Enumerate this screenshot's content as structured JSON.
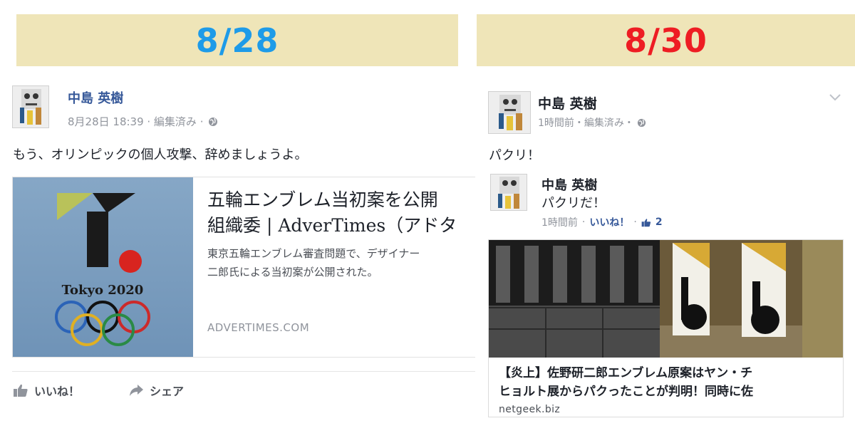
{
  "left_panel": {
    "date": "8/28",
    "author": "中島 英樹",
    "meta": "8月28日 18:39 · 編集済み ·",
    "post_text": "もう、オリンピックの個人攻撃、辞めましょうよ。",
    "link_card": {
      "title": "五輪エンブレム当初案を公開\n組織委 | AdverTimes（アドタ",
      "description": "東京五輪エンブレム審査問題で、デザイナー\n二郎氏による当初案が公開された。",
      "image_caption": "Tokyo 2020",
      "domain": "ADVERTIMES.COM"
    },
    "actions": {
      "like": "いいね！",
      "share": "シェア"
    }
  },
  "right_panel": {
    "date": "8/30",
    "author": "中島 英樹",
    "meta": "1時間前・編集済み・",
    "post_text": "パクリ！",
    "shared_post": {
      "author": "中島 英樹",
      "text": "パクリだ！",
      "time": "1時間前",
      "like_link": "いいね！",
      "like_count": "2"
    },
    "link_card": {
      "title": "【炎上】佐野研二郎エンブレム原案はヤン・チ\nヒョルト展からパクったことが判明！同時に佐",
      "domain": "netgeek.biz"
    }
  },
  "colors": {
    "banner_bg": "#efe5b8",
    "left_date": "#1e9be8",
    "right_date": "#ee1d23",
    "fb_link": "#365899",
    "meta_gray": "#90949c"
  }
}
